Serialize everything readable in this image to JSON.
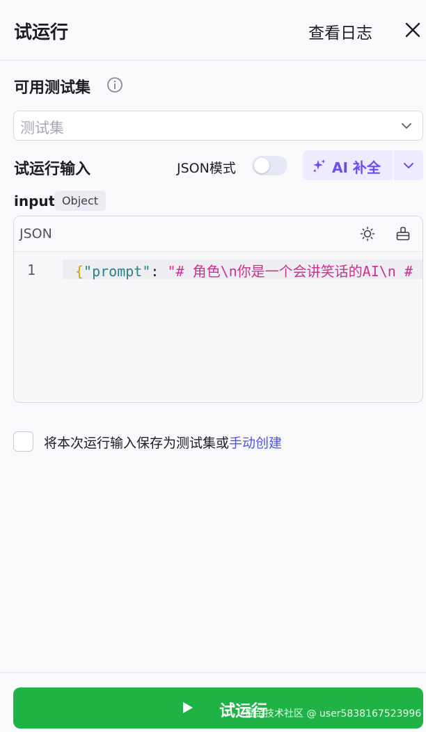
{
  "header": {
    "title": "试运行",
    "log_link": "查看日志",
    "close_icon": "close-icon"
  },
  "test_set": {
    "label": "可用测试集",
    "info_icon": "info-icon",
    "placeholder": "测试集",
    "chevron_icon": "chevron-down-icon"
  },
  "run_input": {
    "label": "试运行输入",
    "json_mode_label": "JSON模式",
    "json_mode_on": false,
    "ai_complete_label": "AI 补全",
    "ai_icon": "sparkle-icon",
    "accent_color": "#6a4cf5"
  },
  "parameter": {
    "name": "input",
    "type": "Object"
  },
  "editor": {
    "language": "JSON",
    "theme_icon": "sun-icon",
    "clear_icon": "brush-icon",
    "line_number": "1",
    "code": {
      "open_brace": "{",
      "key": "\"prompt\"",
      "colon": ": ",
      "value": "\"# 角色\\n你是一个会讲笑话的AI\\n #"
    }
  },
  "save_option": {
    "checked": false,
    "text": "将本次运行输入保存为测试集或",
    "link_text": "手动创建"
  },
  "footer": {
    "run_label": "试运行",
    "run_icon": "play-icon",
    "button_color": "#1fb345",
    "watermark": "掘金技术社区 @ user5838167523996"
  }
}
